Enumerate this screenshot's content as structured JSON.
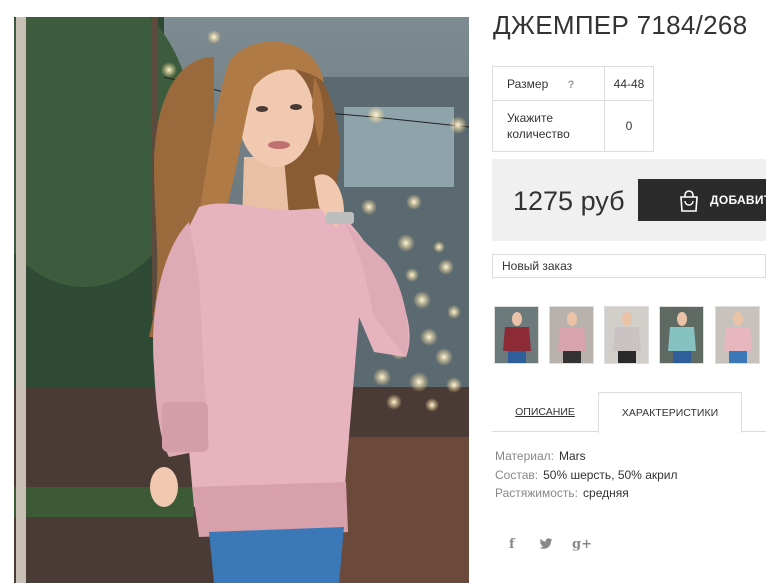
{
  "product": {
    "title": "ДЖЕМПЕР 7184/268",
    "params": {
      "size_label": "Размер",
      "size_help": "?",
      "size_value": "44-48",
      "qty_label_line1": "Укажите",
      "qty_label_line2": "количество",
      "qty_value": "0"
    },
    "price": "1275 руб",
    "add_button_label": "ДОБАВИТЬ",
    "order_select_value": "Новый заказ"
  },
  "thumbnails": [
    {
      "name": "thumb-burgundy",
      "color": "#8c2a36"
    },
    {
      "name": "thumb-pink-1",
      "color": "#d9a3ad"
    },
    {
      "name": "thumb-grey",
      "color": "#c9c3c3"
    },
    {
      "name": "thumb-mint",
      "color": "#86c2c1"
    },
    {
      "name": "thumb-pink-2",
      "color": "#e7b6bf"
    }
  ],
  "tabs": {
    "description": "ОПИСАНИЕ",
    "characteristics": "ХАРАКТЕРИСТИКИ"
  },
  "specs": [
    {
      "key": "Материал:",
      "value": "Mars"
    },
    {
      "key": "Состав:",
      "value": "50% шерсть, 50% акрил"
    },
    {
      "key": "Растяжимость:",
      "value": "средняя"
    }
  ],
  "social": {
    "facebook": "f",
    "twitter": "🐦",
    "googleplus": "g+"
  },
  "colors": {
    "button_bg": "#2b2b2b",
    "price_box_bg": "#f0f0f0",
    "sweater_pink": "#e6b3bf"
  }
}
